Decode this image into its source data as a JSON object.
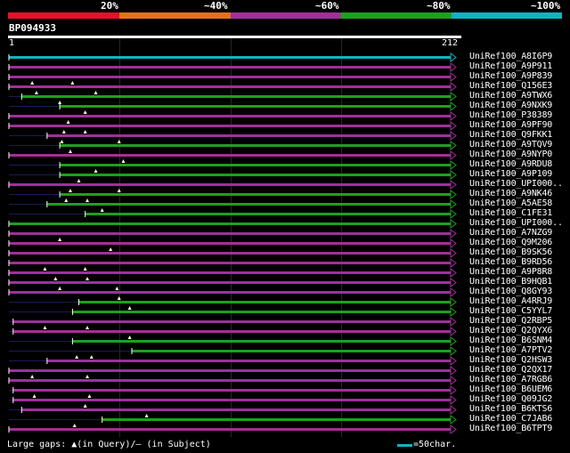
{
  "legend": {
    "labels": [
      "20%",
      "~40%",
      "~60%",
      "~80%",
      "~100%"
    ],
    "colors": [
      "#e8102a",
      "#e8701b",
      "#a0309a",
      "#1ea01e",
      "#10b4c0"
    ]
  },
  "query": {
    "id": "BP094933",
    "start": "1",
    "end": "212"
  },
  "hits": [
    {
      "label": "UniRef100_A8I6P9",
      "color": "#10b4c0",
      "start": 1,
      "end": 212,
      "gap": 0,
      "marks": []
    },
    {
      "label": "UniRef100_A9P911",
      "color": "#a0309a",
      "start": 1,
      "end": 212,
      "gap": 0,
      "marks": []
    },
    {
      "label": "UniRef100_A9P839",
      "color": "#a0309a",
      "start": 1,
      "end": 212,
      "gap": 0,
      "marks": []
    },
    {
      "label": "UniRef100_Q156E3",
      "color": "#a0309a",
      "start": 1,
      "end": 212,
      "gap": 0,
      "marks": [
        12,
        31
      ]
    },
    {
      "label": "UniRef100_A9TWX6",
      "color": "#1ea01e",
      "start": 7,
      "end": 212,
      "gap": 0,
      "marks": [
        14,
        42
      ]
    },
    {
      "label": "UniRef100_A9NXK9",
      "color": "#1ea01e",
      "start": 25,
      "end": 212,
      "gap": 0,
      "marks": [
        25
      ]
    },
    {
      "label": "UniRef100_P38389",
      "color": "#a0309a",
      "start": 1,
      "end": 212,
      "gap": 0,
      "marks": [
        37
      ]
    },
    {
      "label": "UniRef100_A9PF90",
      "color": "#a0309a",
      "start": 1,
      "end": 212,
      "gap": 0,
      "marks": [
        29
      ]
    },
    {
      "label": "UniRef100_Q9FKK1",
      "color": "#a0309a",
      "start": 19,
      "end": 212,
      "gap": 0,
      "marks": [
        27,
        37
      ]
    },
    {
      "label": "UniRef100_A9TQV9",
      "color": "#1ea01e",
      "start": 25,
      "end": 212,
      "gap": 0,
      "marks": [
        26,
        53
      ]
    },
    {
      "label": "UniRef100_A9NYP0",
      "color": "#a0309a",
      "start": 1,
      "end": 212,
      "gap": 0,
      "marks": [
        30
      ]
    },
    {
      "label": "UniRef100_A9RDU8",
      "color": "#1ea01e",
      "start": 25,
      "end": 212,
      "gap": 0,
      "marks": [
        55
      ]
    },
    {
      "label": "UniRef100_A9P109",
      "color": "#1ea01e",
      "start": 25,
      "end": 212,
      "gap": 0,
      "marks": [
        42
      ]
    },
    {
      "label": "UniRef100_UPI000..",
      "color": "#a0309a",
      "start": 1,
      "end": 212,
      "gap": 0,
      "marks": [
        34
      ]
    },
    {
      "label": "UniRef100_A9NK46",
      "color": "#1ea01e",
      "start": 25,
      "end": 212,
      "gap": 0,
      "marks": [
        30,
        53
      ]
    },
    {
      "label": "UniRef100_A5AE58",
      "color": "#1ea01e",
      "start": 19,
      "end": 212,
      "gap": 0,
      "marks": [
        28,
        38
      ]
    },
    {
      "label": "UniRef100_C1FE31",
      "color": "#1ea01e",
      "start": 37,
      "end": 212,
      "gap": 0,
      "marks": [
        45
      ]
    },
    {
      "label": "UniRef100_UPI000..",
      "color": "#1ea01e",
      "start": 1,
      "end": 212,
      "gap": 0,
      "marks": []
    },
    {
      "label": "UniRef100_A7NZG9",
      "color": "#a0309a",
      "start": 1,
      "end": 212,
      "gap": 0,
      "marks": []
    },
    {
      "label": "UniRef100_Q9M206",
      "color": "#a0309a",
      "start": 1,
      "end": 212,
      "gap": 0,
      "marks": [
        25
      ]
    },
    {
      "label": "UniRef100_B9SK56",
      "color": "#a0309a",
      "start": 1,
      "end": 212,
      "gap": 0,
      "marks": [
        49
      ]
    },
    {
      "label": "UniRef100_B9RD56",
      "color": "#a0309a",
      "start": 1,
      "end": 212,
      "gap": 0,
      "marks": []
    },
    {
      "label": "UniRef100_A9P8R8",
      "color": "#a0309a",
      "start": 1,
      "end": 212,
      "gap": 0,
      "marks": [
        18,
        37
      ]
    },
    {
      "label": "UniRef100_B9HQB1",
      "color": "#a0309a",
      "start": 1,
      "end": 212,
      "gap": 0,
      "marks": [
        23,
        38
      ]
    },
    {
      "label": "UniRef100_Q8GY93",
      "color": "#a0309a",
      "start": 1,
      "end": 212,
      "gap": 0,
      "marks": [
        25,
        52
      ]
    },
    {
      "label": "UniRef100_A4RRJ9",
      "color": "#1ea01e",
      "start": 34,
      "end": 212,
      "gap": 0,
      "marks": [
        53
      ]
    },
    {
      "label": "UniRef100_C5YYL7",
      "color": "#1ea01e",
      "start": 31,
      "end": 212,
      "gap": 0,
      "marks": [
        58
      ]
    },
    {
      "label": "UniRef100_Q2RBP5",
      "color": "#a0309a",
      "start": 3,
      "end": 212,
      "gap": 0,
      "marks": []
    },
    {
      "label": "UniRef100_Q2QYX6",
      "color": "#a0309a",
      "start": 3,
      "end": 212,
      "gap": 0,
      "marks": [
        18,
        38
      ]
    },
    {
      "label": "UniRef100_B6SNM4",
      "color": "#1ea01e",
      "start": 31,
      "end": 212,
      "gap": 0,
      "marks": [
        58
      ]
    },
    {
      "label": "UniRef100_A7PTV2",
      "color": "#1ea01e",
      "start": 59,
      "end": 212,
      "gap": 0,
      "marks": []
    },
    {
      "label": "UniRef100_Q2HSW3",
      "color": "#a0309a",
      "start": 19,
      "end": 212,
      "gap": 0,
      "marks": [
        33,
        40
      ]
    },
    {
      "label": "UniRef100_Q2QX17",
      "color": "#a0309a",
      "start": 1,
      "end": 212,
      "gap": 0,
      "marks": []
    },
    {
      "label": "UniRef100_A7RGB6",
      "color": "#a0309a",
      "start": 1,
      "end": 212,
      "gap": 0,
      "marks": [
        12,
        38
      ]
    },
    {
      "label": "UniRef100_B6UEM6",
      "color": "#a0309a",
      "start": 3,
      "end": 212,
      "gap": 0,
      "marks": []
    },
    {
      "label": "UniRef100_Q09JG2",
      "color": "#a0309a",
      "start": 3,
      "end": 212,
      "gap": 0,
      "marks": [
        13,
        39
      ]
    },
    {
      "label": "UniRef100_B6KTS6",
      "color": "#a0309a",
      "start": 7,
      "end": 212,
      "gap": 0,
      "marks": [
        37
      ]
    },
    {
      "label": "UniRef100_C7JAB6",
      "color": "#1ea01e",
      "start": 45,
      "end": 212,
      "gap": 0,
      "marks": [
        66
      ]
    },
    {
      "label": "UniRef100_B6TPT9",
      "color": "#a0309a",
      "start": 1,
      "end": 212,
      "gap": 0,
      "marks": [
        32
      ]
    }
  ],
  "footer": {
    "gaps_text": "Large gaps: ▲(in Query)/– (in Subject)",
    "scale_text": "=50char.",
    "scale_color": "#10b4c0"
  }
}
